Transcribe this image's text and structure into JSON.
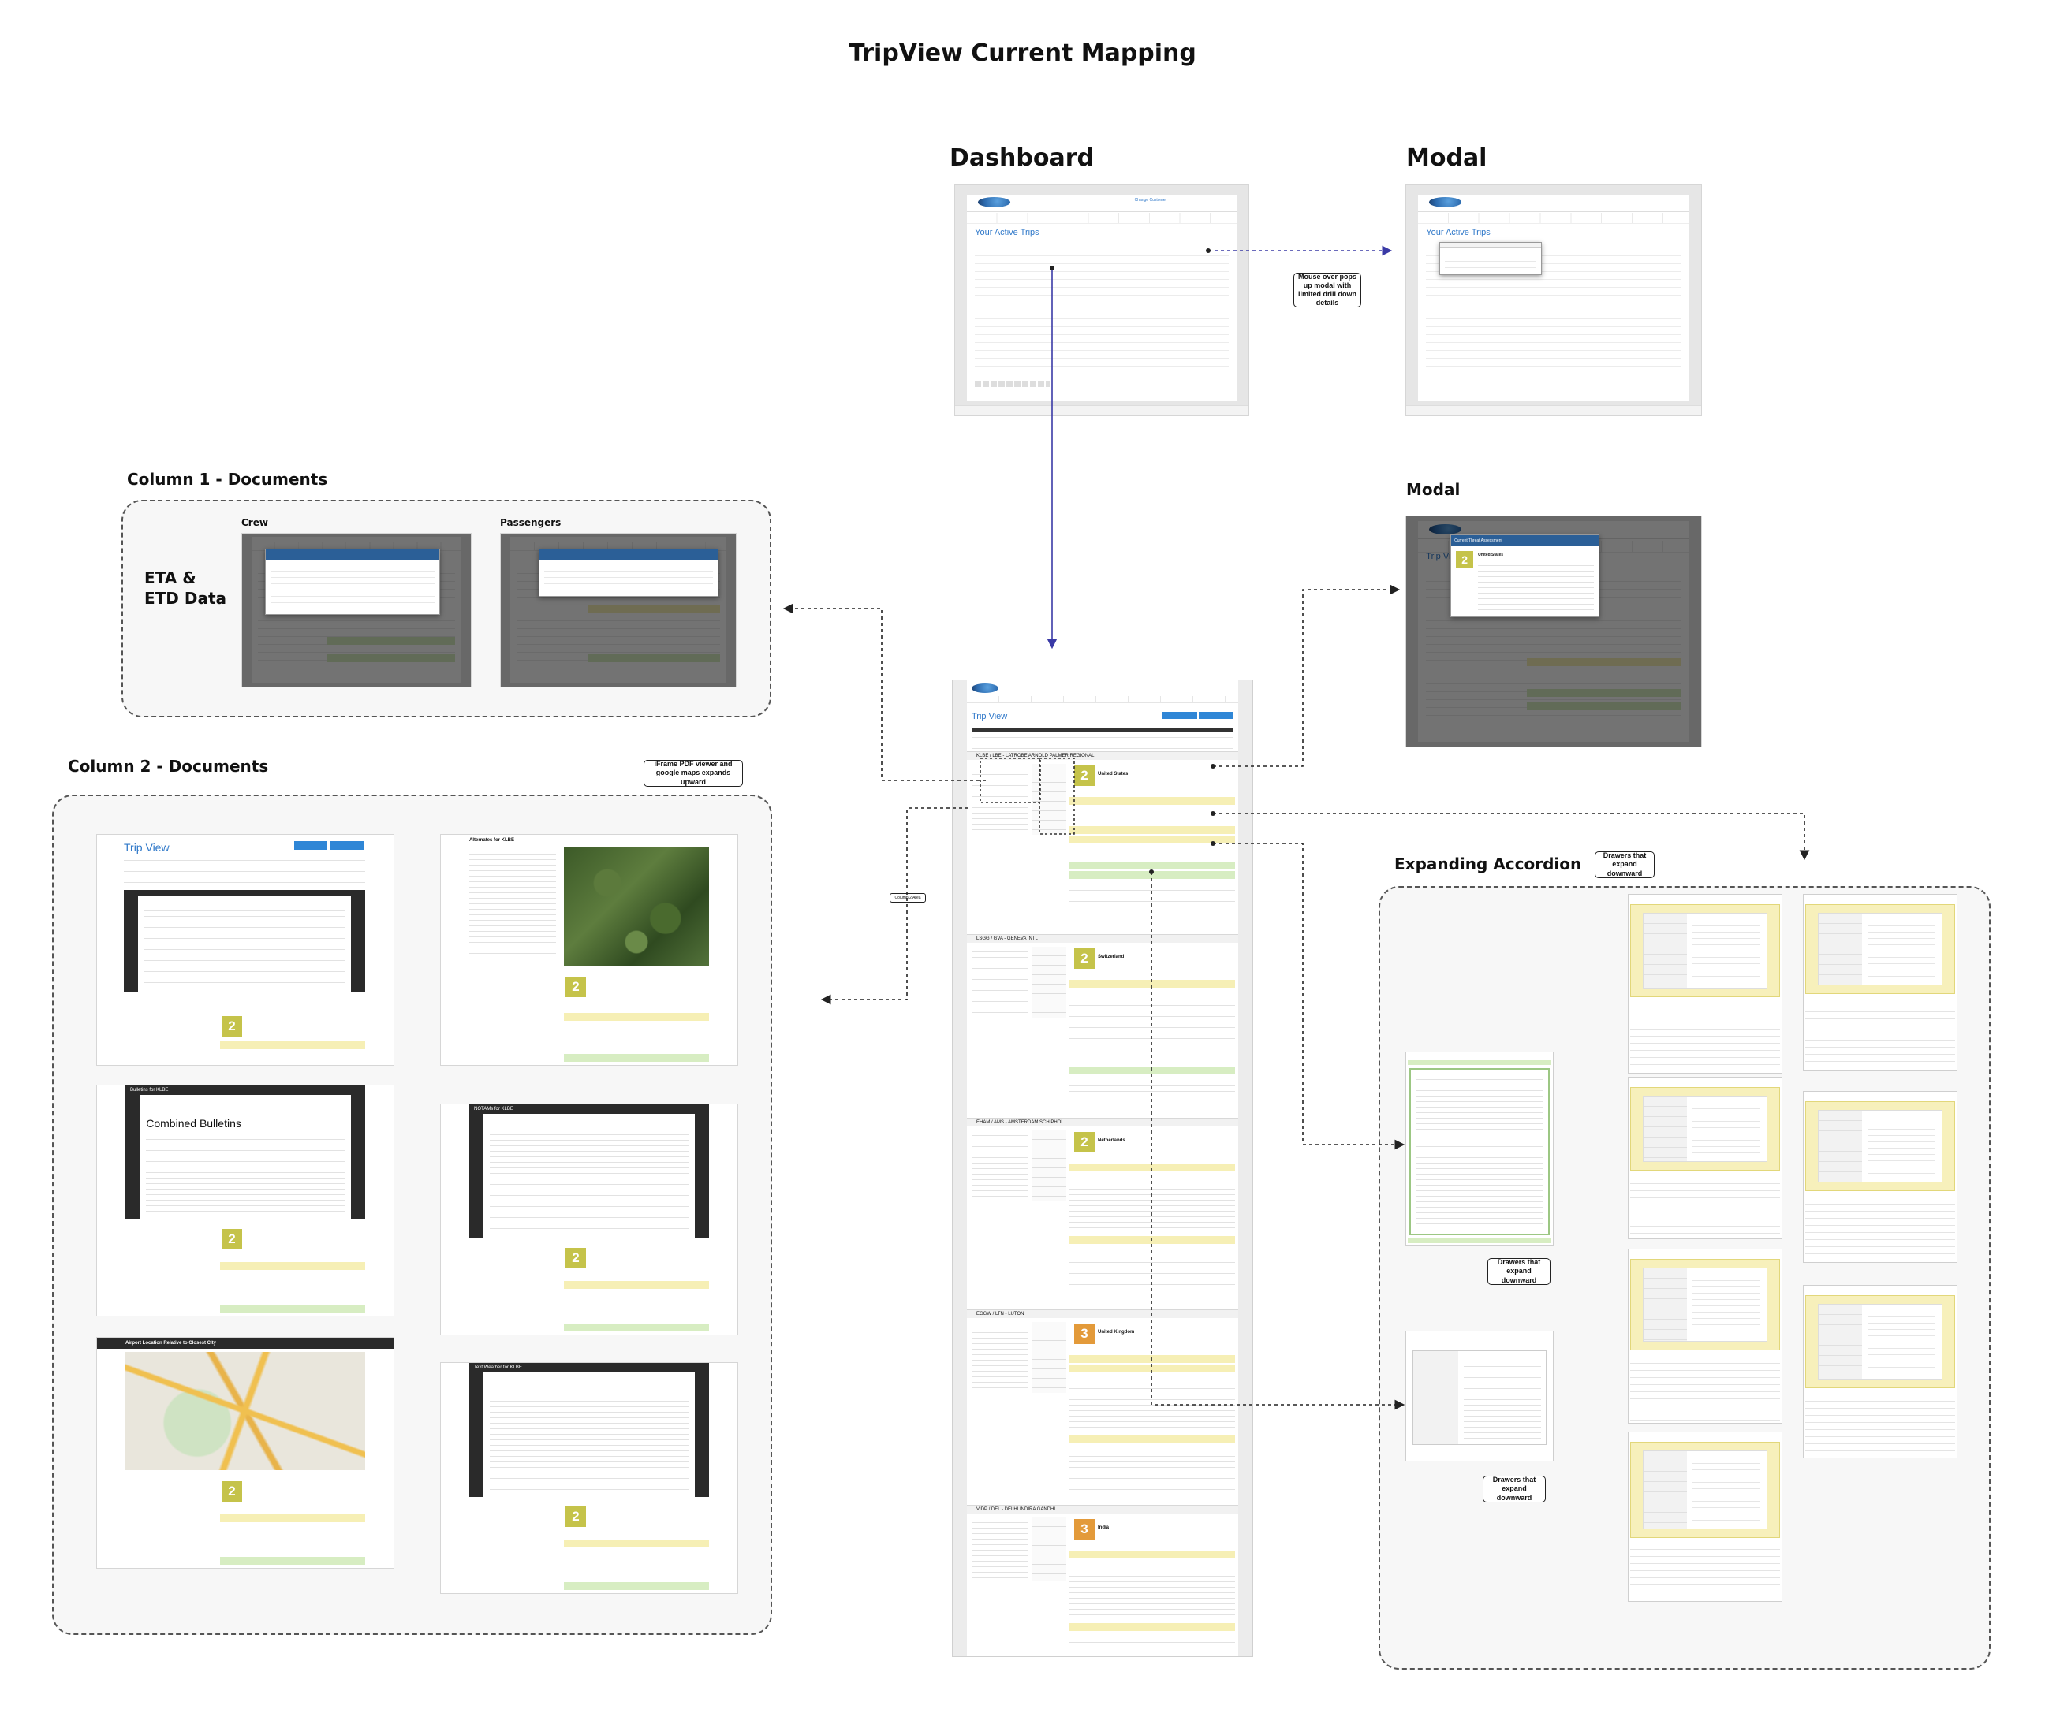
{
  "title": "TripView Current Mapping",
  "sections": {
    "dashboard": "Dashboard",
    "modal_top": "Modal",
    "modal_mid": "Modal",
    "column1": "Column 1 - Documents",
    "column2": "Column 2 - Documents",
    "accordion": "Expanding Accordion"
  },
  "column1": {
    "crew_label": "Crew",
    "passengers_label": "Passengers",
    "eta_label_1": "ETA &",
    "eta_label_2": "ETD Data"
  },
  "screens": {
    "active_trips": "Your Active Trips",
    "trip_view": "Trip View",
    "change_customer": "Change Customer",
    "threat_title": "Current Threat Assessment",
    "threat_country": "United States",
    "legs": [
      {
        "label": "KLBE / LBE - LATROBE ARNOLD PALMER REGIONAL",
        "country": "United States",
        "level": "2",
        "tone": "g"
      },
      {
        "label": "LSGG / GVA - GENEVA INTL",
        "country": "Switzerland",
        "level": "2",
        "tone": "g"
      },
      {
        "label": "EHAM / AMS - AMSTERDAM SCHIPHOL",
        "country": "Netherlands",
        "level": "2",
        "tone": "g"
      },
      {
        "label": "EGGW / LTN - LUTON",
        "country": "United Kingdom",
        "level": "3",
        "tone": "o"
      },
      {
        "label": "VIDP / DEL - DELHI INDIRA GANDHI",
        "country": "India",
        "level": "3",
        "tone": "o"
      }
    ]
  },
  "documents": {
    "trip_view": "Trip View",
    "alternates": "Alternates for KLBE",
    "bulletins": "Bulletins for KLBE",
    "combined_bulletins": "Combined Bulletins",
    "notams": "NOTAMs for KLBE",
    "airport_location": "Airport Location Relative to Closest City",
    "text_weather": "Text Weather for KLBE"
  },
  "callouts": {
    "mouse_over": "Mouse over pops up modal with limited drill down details",
    "iframe": "iFrame PDF viewer and google maps expands upward",
    "drawers_1": "Drawers that expand downward",
    "drawers_2": "Drawers that expand downward",
    "drawers_3": "Drawers that expand downward",
    "column2_tag": "Column 2 Area"
  }
}
